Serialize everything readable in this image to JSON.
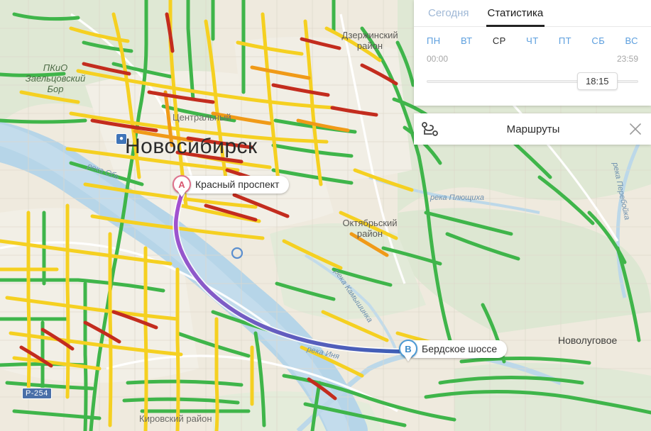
{
  "panel": {
    "tabs": [
      {
        "label": "Сегодня",
        "active": false
      },
      {
        "label": "Статистика",
        "active": true
      }
    ],
    "weekdays": [
      {
        "label": "ПН",
        "active": false
      },
      {
        "label": "ВТ",
        "active": false
      },
      {
        "label": "СР",
        "active": true
      },
      {
        "label": "ЧТ",
        "active": false
      },
      {
        "label": "ПТ",
        "active": false
      },
      {
        "label": "СБ",
        "active": false
      },
      {
        "label": "ВС",
        "active": false
      }
    ],
    "time_start": "00:00",
    "time_end": "23:59",
    "slider_value": "18:15"
  },
  "routes_bar": {
    "icon": "route-icon",
    "title": "Маршруты",
    "close_icon": "close-icon"
  },
  "map": {
    "city": "Новосибирск",
    "markers": [
      {
        "letter": "A",
        "label": "Красный проспект",
        "color": "#d8566f"
      },
      {
        "letter": "B",
        "label": "Бердское шоссе",
        "color": "#3d8bc8"
      }
    ],
    "districts": [
      {
        "line1": "Дзержинский",
        "line2": "район"
      },
      {
        "line1": "Октябрьский",
        "line2": "район"
      },
      {
        "line1": "Центральный",
        "line2": ""
      },
      {
        "line1": "Кировский район",
        "line2": ""
      }
    ],
    "park": {
      "line1": "ПКиО",
      "line2": "Заельцовский",
      "line3": "Бор"
    },
    "town": "Новолуговое",
    "rivers": [
      "река Обь",
      "река Плющиха",
      "река Камышинка",
      "река Иня",
      "река Перебойка"
    ],
    "road_shield": "Р-254",
    "transit_icon": "train-station-icon",
    "traffic_colors": {
      "free": "#3fb54a",
      "moderate": "#f5d021",
      "slow": "#f09a18",
      "jam": "#c32c1e"
    },
    "route_colors": {
      "start": "#a84fd1",
      "end": "#3b5fb5"
    }
  }
}
